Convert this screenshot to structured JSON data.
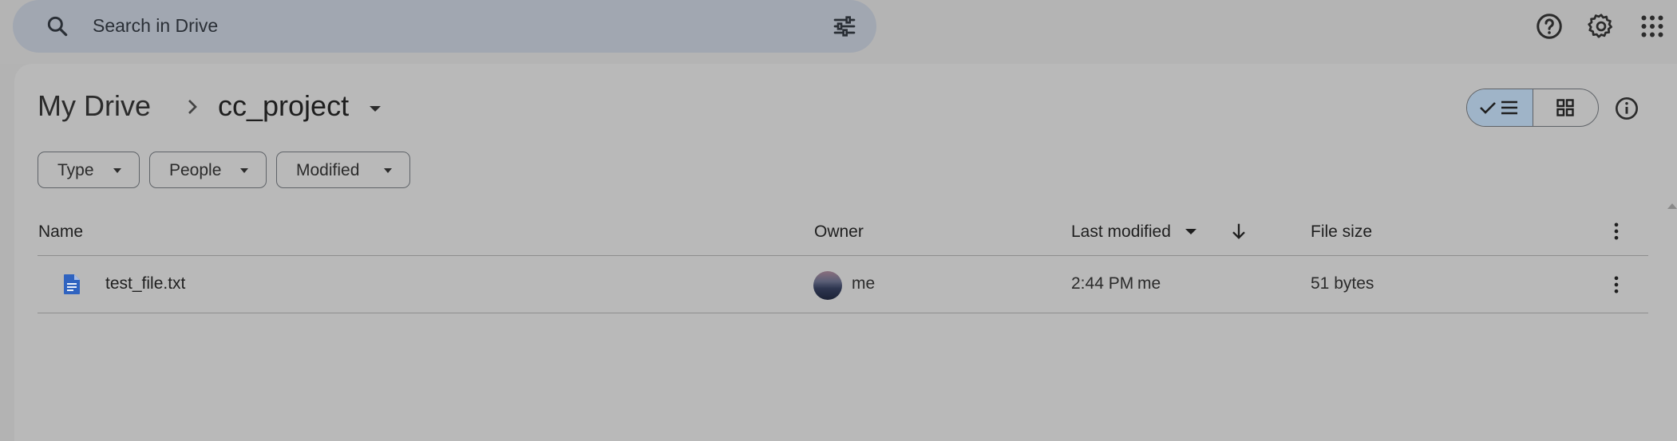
{
  "search": {
    "placeholder": "Search in Drive"
  },
  "breadcrumb": {
    "root": "My Drive",
    "current": "cc_project"
  },
  "filters": [
    {
      "label": "Type"
    },
    {
      "label": "People"
    },
    {
      "label": "Modified"
    }
  ],
  "view": {
    "mode": "list"
  },
  "table": {
    "columns": {
      "name": "Name",
      "owner": "Owner",
      "last_modified": "Last modified",
      "file_size": "File size"
    },
    "rows": [
      {
        "name": "test_file.txt",
        "icon": "doc-icon",
        "owner": "me",
        "modified_time": "2:44 PM",
        "modified_by": "me",
        "size": "51 bytes"
      }
    ]
  },
  "colors": {
    "search_bg": "#a1a7b1",
    "page_bg": "#b3b3b3",
    "selected_toggle": "#9fb4c8",
    "doc_icon": "#2f63c0"
  }
}
